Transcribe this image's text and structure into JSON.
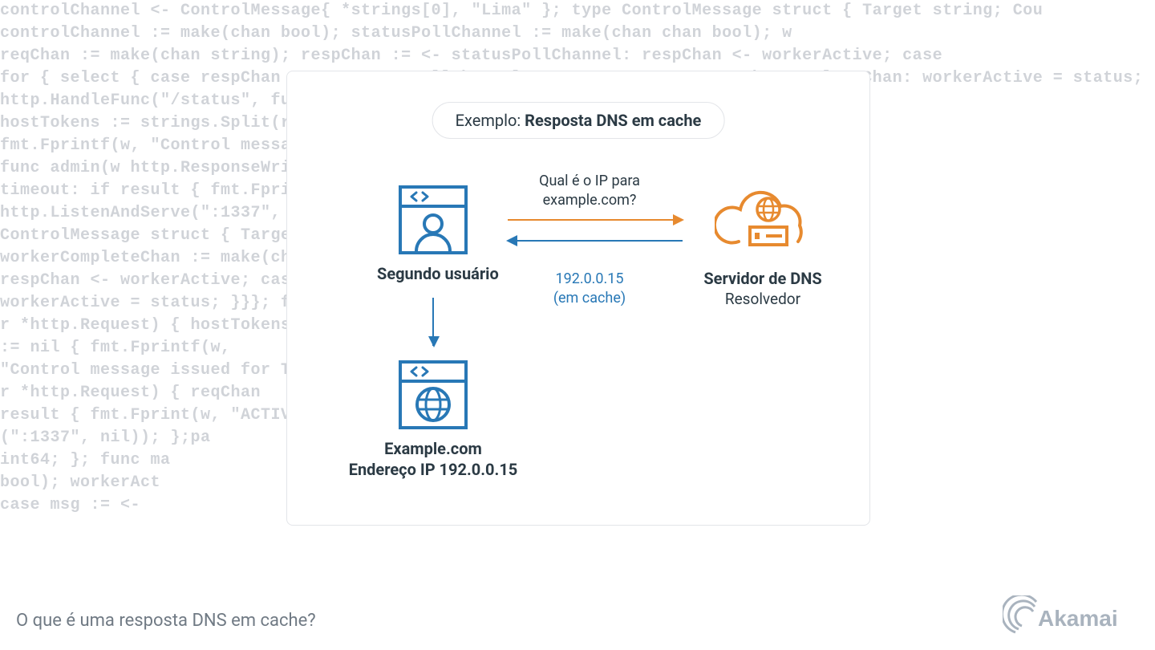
{
  "colors": {
    "blue": "#2878b6",
    "orange": "#e78a2f",
    "text": "#2b3a44",
    "muted": "#707a84"
  },
  "diagram": {
    "pill_prefix": "Exemplo: ",
    "pill_bold": "Resposta DNS em cache",
    "user": {
      "title": "Segundo usuário"
    },
    "dns": {
      "title": "Servidor de DNS",
      "subtitle": "Resolvedor"
    },
    "site": {
      "title": "Example.com",
      "subtitle": "Endereço IP 192.0.0.15"
    },
    "query_line1": "Qual é o IP para",
    "query_line2": "example.com?",
    "response_line1": "192.0.0.15",
    "response_line2": "(em cache)"
  },
  "caption": "O que é uma resposta DNS em cache?",
  "brand": "Akamai",
  "bg_code": "controlChannel <- ControlMessage{ *strings[0], \"Lima\" }; type ControlMessage struct { Target string; Cou\ncontrolChannel := make(chan bool); statusPollChannel := make(chan chan bool); w\nreqChan := make(chan string); respChan := <- statusPollChannel: respChan <- workerActive; case\nfor { select { case respChan := <- statusPollChannel; case status := <- workerCompleteChan: workerActive = status;\nhttp.HandleFunc(\"/status\", func(w http.ResponseWriter, r *http.Request) { hostTok\nhostTokens := strings.Split(r.Host, \":\"); if err != nil { fmt.Fprintf(w,\nfmt.Fprintf(w, \"Control message issued for Ta\nfunc admin(w http.ResponseWriter, r *http.Request) { reqChan\ntimeout: if result { fmt.Fprint(w, \"ACTIVE\" \nhttp.ListenAndServe(\":1337\", nil)); };pa\nControlMessage struct { Target string; Count int64; }; func ma\nworkerCompleteChan := make(chan chan bool); workerAct\nrespChan <- workerActive; case msg := <-\nworkerActive = status; }}}; func admin(\nr *http.Request) { hostTokens\n:= nil { fmt.Fprintf(w,\n\"Control message issued for Ta\nr *http.Request) { reqChan\nresult { fmt.Fprint(w, \"ACTIVE\"\n(\":1337\", nil)); };pa\nint64; }; func ma\nbool); workerAct\ncase msg := <-"
}
